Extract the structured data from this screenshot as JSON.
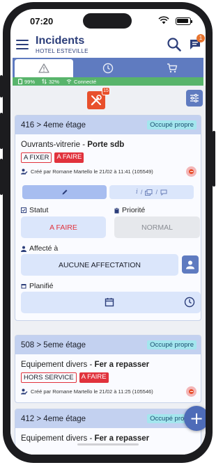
{
  "status": {
    "time": "07:20"
  },
  "header": {
    "title": "Incidents",
    "subtitle": "HOTEL ESTEVILLE",
    "chat_count": "1"
  },
  "tabs": [
    {
      "icon": "warning-icon",
      "active": true
    },
    {
      "icon": "clock-icon",
      "active": false
    },
    {
      "icon": "cart-icon",
      "active": false
    }
  ],
  "connection": {
    "battery": "99%",
    "signal": "32%",
    "state": "Connecté"
  },
  "toolbar": {
    "tool_badge": "15"
  },
  "incidents": [
    {
      "room": "416 > 4eme étage",
      "occupancy": "Occupé propre",
      "category": "Ouvrants-vitrerie",
      "separator": "-",
      "item": "Porte sdb",
      "tags": [
        "A FIXER",
        "A FAIRE"
      ],
      "creator": "Créé par Romane Martello le 21/02 à 11:41 (105549)",
      "statut_label": "Statut",
      "statut_value": "A FAIRE",
      "priorite_label": "Priorité",
      "priorite_value": "NORMAL",
      "affecte_label": "Affecté à",
      "affecte_value": "AUCUNE AFFECTATION",
      "planifie_label": "Planifié",
      "subtab_sep": "/"
    },
    {
      "room": "508 > 5eme étage",
      "occupancy": "Occupé propre",
      "category": "Equipement divers",
      "separator": "-",
      "item": "Fer a repasser",
      "tags": [
        "HORS SERVICE",
        "A FAIRE"
      ],
      "creator": "Créé par Romane Martello le 21/02 à 11:25 (105546)"
    },
    {
      "room": "412 > 4eme étage",
      "occupancy": "Occupé propre",
      "category": "Equipement divers",
      "separator": "-",
      "item": "Fer a repasser"
    }
  ],
  "colors": {
    "accent": "#5f7bc0",
    "danger": "#e1323c",
    "success": "#58b46b",
    "brand_text": "#2c3e7a"
  }
}
